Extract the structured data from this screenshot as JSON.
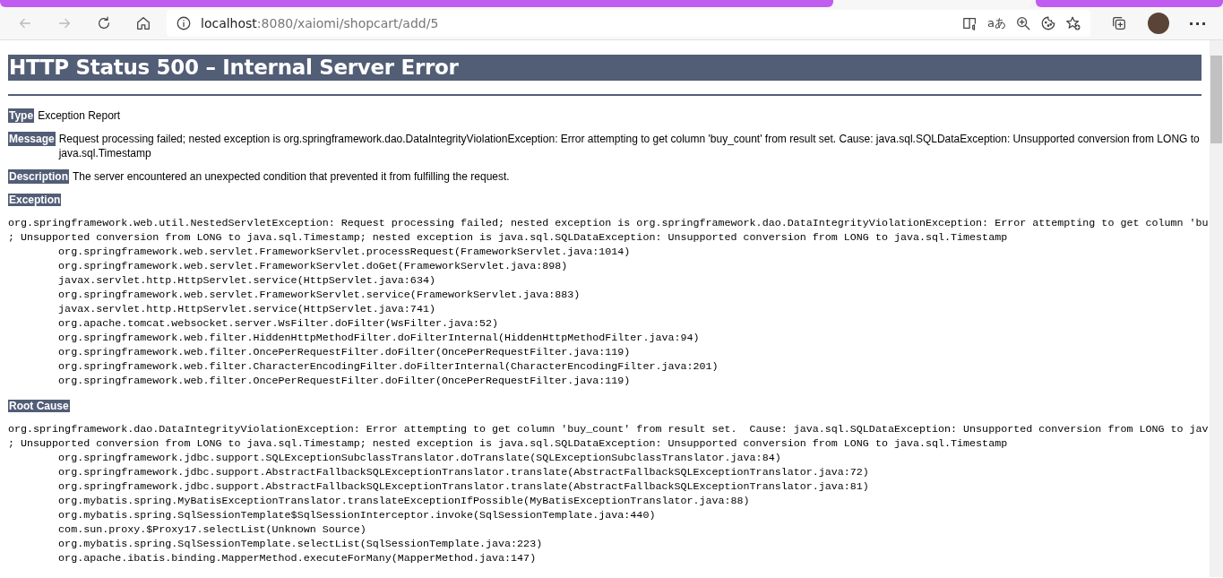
{
  "browser": {
    "tabs": [
      {
        "selected": false
      },
      {
        "selected": true
      },
      {
        "selected": false
      }
    ],
    "back_disabled": true,
    "forward_disabled": true,
    "address": {
      "host": "localhost",
      "path": ":8080/xaiomi/shopcart/add/5"
    },
    "read_aloud_glyph": "aあ",
    "more_glyph": "···"
  },
  "page": {
    "title": "HTTP Status 500 – Internal Server Error",
    "sections": [
      {
        "kind": "field",
        "label": "Type",
        "text": "Exception Report"
      },
      {
        "kind": "field",
        "label": "Message",
        "text": "Request processing failed; nested exception is org.springframework.dao.DataIntegrityViolationException: Error attempting to get column 'buy_count' from result set. Cause: java.sql.SQLDataException: Unsupported conversion from LONG to java.sql.Timestamp"
      },
      {
        "kind": "field",
        "label": "Description",
        "text": "The server encountered an unexpected condition that prevented it from fulfilling the request."
      },
      {
        "kind": "trace",
        "label": "Exception",
        "lines": [
          "org.springframework.web.util.NestedServletException: Request processing failed; nested exception is org.springframework.dao.DataIntegrityViolationException: Error attempting to get column 'bu",
          "; Unsupported conversion from LONG to java.sql.Timestamp; nested exception is java.sql.SQLDataException: Unsupported conversion from LONG to java.sql.Timestamp",
          "\torg.springframework.web.servlet.FrameworkServlet.processRequest(FrameworkServlet.java:1014)",
          "\torg.springframework.web.servlet.FrameworkServlet.doGet(FrameworkServlet.java:898)",
          "\tjavax.servlet.http.HttpServlet.service(HttpServlet.java:634)",
          "\torg.springframework.web.servlet.FrameworkServlet.service(FrameworkServlet.java:883)",
          "\tjavax.servlet.http.HttpServlet.service(HttpServlet.java:741)",
          "\torg.apache.tomcat.websocket.server.WsFilter.doFilter(WsFilter.java:52)",
          "\torg.springframework.web.filter.HiddenHttpMethodFilter.doFilterInternal(HiddenHttpMethodFilter.java:94)",
          "\torg.springframework.web.filter.OncePerRequestFilter.doFilter(OncePerRequestFilter.java:119)",
          "\torg.springframework.web.filter.CharacterEncodingFilter.doFilterInternal(CharacterEncodingFilter.java:201)",
          "\torg.springframework.web.filter.OncePerRequestFilter.doFilter(OncePerRequestFilter.java:119)"
        ]
      },
      {
        "kind": "trace",
        "label": "Root Cause",
        "lines": [
          "org.springframework.dao.DataIntegrityViolationException: Error attempting to get column 'buy_count' from result set.  Cause: java.sql.SQLDataException: Unsupported conversion from LONG to jav",
          "; Unsupported conversion from LONG to java.sql.Timestamp; nested exception is java.sql.SQLDataException: Unsupported conversion from LONG to java.sql.Timestamp",
          "\torg.springframework.jdbc.support.SQLExceptionSubclassTranslator.doTranslate(SQLExceptionSubclassTranslator.java:84)",
          "\torg.springframework.jdbc.support.AbstractFallbackSQLExceptionTranslator.translate(AbstractFallbackSQLExceptionTranslator.java:72)",
          "\torg.springframework.jdbc.support.AbstractFallbackSQLExceptionTranslator.translate(AbstractFallbackSQLExceptionTranslator.java:81)",
          "\torg.mybatis.spring.MyBatisExceptionTranslator.translateExceptionIfPossible(MyBatisExceptionTranslator.java:88)",
          "\torg.mybatis.spring.SqlSessionTemplate$SqlSessionInterceptor.invoke(SqlSessionTemplate.java:440)",
          "\tcom.sun.proxy.$Proxy17.selectList(Unknown Source)",
          "\torg.mybatis.spring.SqlSessionTemplate.selectList(SqlSessionTemplate.java:223)",
          "\torg.apache.ibatis.binding.MapperMethod.executeForMany(MapperMethod.java:147)"
        ]
      }
    ]
  }
}
